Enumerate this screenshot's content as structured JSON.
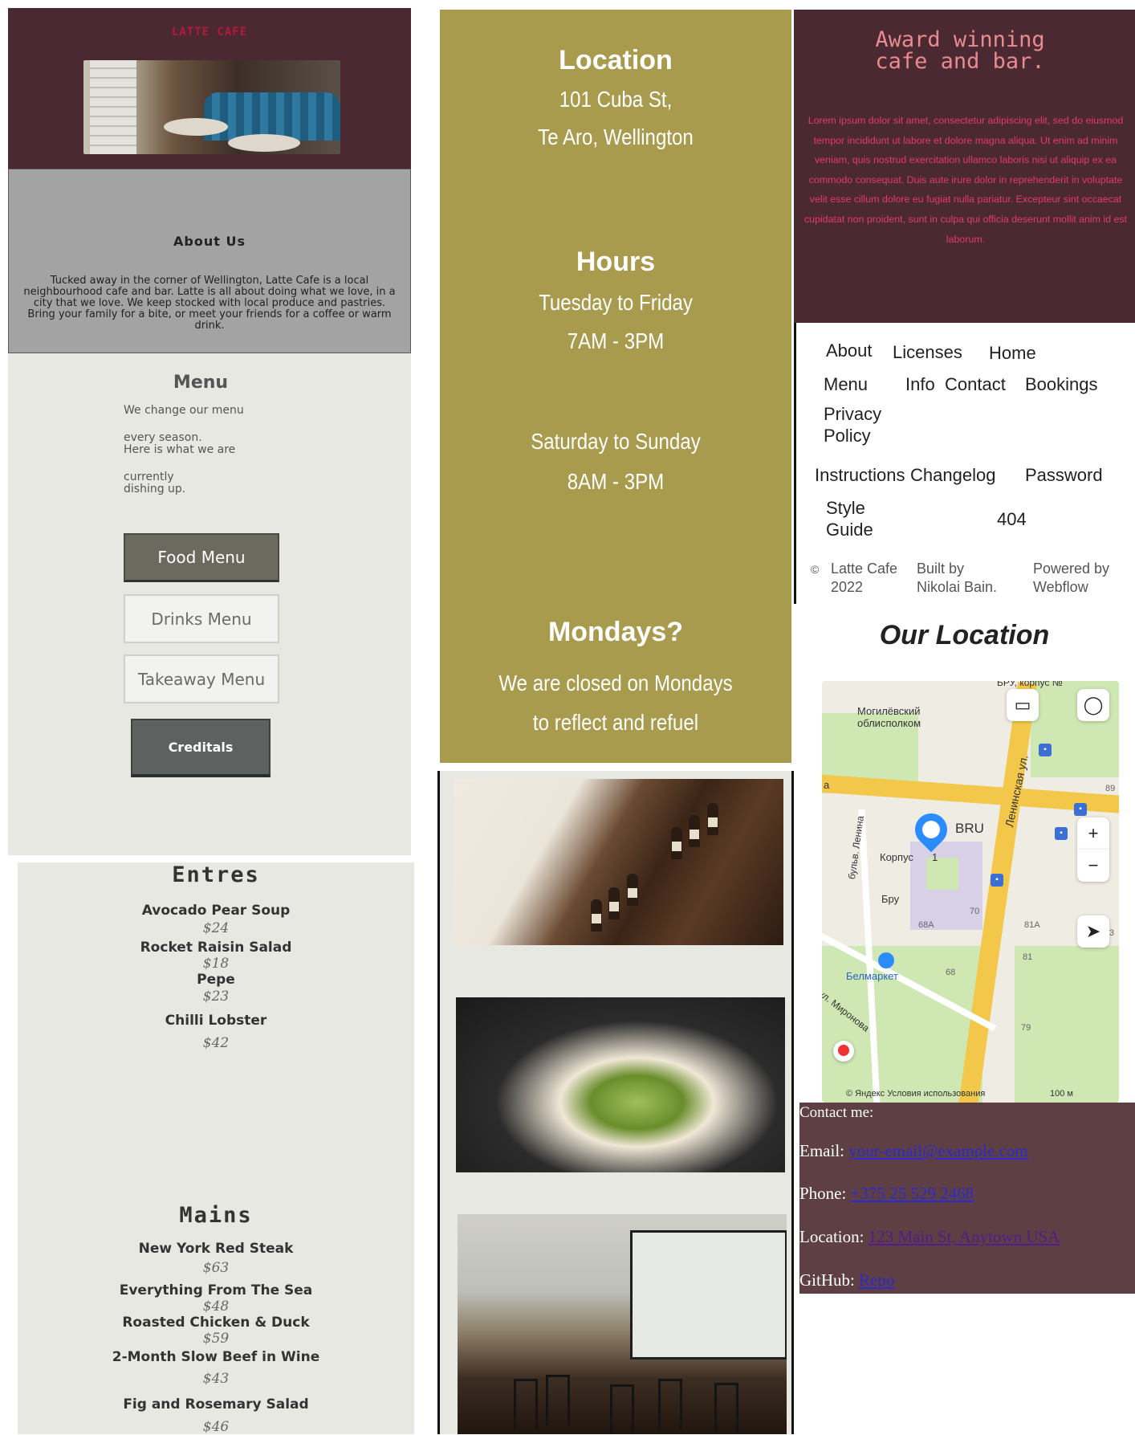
{
  "hero": {
    "brand": "LATTE CAFE"
  },
  "about": {
    "title": "About  Us",
    "text": "Tucked away in the corner of Wellington, Latte Cafe is a local neighbourhood cafe and bar. Latte is all about doing what we love, in a city that we love. We keep stocked with local produce and pastries. Bring your family for a bite, or meet your friends for a coffee or warm drink."
  },
  "menu": {
    "title": "Menu",
    "lines": [
      "We change our menu",
      "every season.",
      "Here is what we are",
      "currently",
      "dishing up."
    ],
    "buttons": {
      "food": "Food Menu",
      "drinks": "Drinks Menu",
      "takeaway": "Takeaway Menu",
      "creditals": "Creditals"
    }
  },
  "food": {
    "entres_title": "Entres",
    "entres": [
      {
        "name": "Avocado Pear Soup",
        "price": "$24"
      },
      {
        "name": "Rocket Raisin Salad",
        "price": "$18"
      },
      {
        "name": "Pepe",
        "price": "$23"
      },
      {
        "name": "Chilli Lobster",
        "price": "$42"
      }
    ],
    "mains_title": "Mains",
    "mains": [
      {
        "name": "New York Red Steak",
        "price": "$63"
      },
      {
        "name": "Everything From The Sea",
        "price": "$48"
      },
      {
        "name": "Roasted Chicken & Duck",
        "price": "$59"
      },
      {
        "name": "2-Month Slow Beef in Wine",
        "price": "$43"
      },
      {
        "name": "Fig and Rosemary Salad",
        "price": "$46"
      }
    ]
  },
  "info": {
    "location_title": "Location",
    "address1": "101 Cuba St,",
    "address2": "Te Aro, Wellington",
    "hours_title": "Hours",
    "weekday": "Tuesday to Friday",
    "weekday_hours": "7AM - 3PM",
    "weekend": "Saturday to Sunday",
    "weekend_hours": "8AM - 3PM",
    "mondays_title": "Mondays?",
    "mondays1": "We are closed on Mondays",
    "mondays2": "to reflect and refuel"
  },
  "award": {
    "title1": "Award winning",
    "title2": "cafe and bar.",
    "text": "Lorem ipsum dolor sit amet, consectetur adipiscing elit, sed do eiusmod tempor incididunt ut labore et dolore magna aliqua. Ut enim ad minim veniam, quis nostrud exercitation ullamco laboris nisi ut aliquip ex ea commodo consequat. Duis aute irure dolor in reprehenderit in voluptate velit esse cillum dolore eu fugiat nulla pariatur. Excepteur sint occaecat cupidatat non proident, sunt in culpa qui officia deserunt mollit anim id est laborum."
  },
  "links": {
    "about": "About",
    "licenses": "Licenses",
    "home": "Home",
    "menu": "Menu",
    "info": "Info",
    "contact": "Contact",
    "bookings": "Bookings",
    "privacy1": "Privacy",
    "privacy2": "Policy",
    "instructions": "Instructions",
    "changelog": "Changelog",
    "password": "Password",
    "style1": "Style",
    "style2": "Guide",
    "notfound": "404",
    "copy_symbol": "©",
    "copy1": "Latte Cafe",
    "copy2": "2022",
    "built1": "Built by",
    "built2": "Nikolai Bain.",
    "powered1": "Powered by",
    "powered2": "Webflow"
  },
  "location": {
    "title": "Our Location"
  },
  "map": {
    "top_label": "БРУ, корпус №",
    "label_mogilev1": "Могилёвский",
    "label_mogilev2": "облисполком",
    "label_bru": "BRU",
    "label_korpus": "Корпус",
    "label_korpus_num": "1",
    "label_bru2": "Бру",
    "street_lenina": "бульв. Ленина",
    "street_leninskaya": "Ленинская ул.",
    "label_belmarket": "Белмаркет",
    "street_mironova": "ул. Миронова",
    "num_68a": "68А",
    "num_70": "70",
    "num_81a": "81А",
    "num_81": "81",
    "num_68": "68",
    "num_79": "79",
    "num_89": "89",
    "edge_a": "а",
    "edge_b": "3",
    "attrib": "© Яндекс  Условия использования",
    "scale": "100 м",
    "zoom_in": "+",
    "zoom_out": "−"
  },
  "contact": {
    "heading": "Contact me:",
    "email_label": "Email: ",
    "email": "your-email@example.com",
    "phone_label": "Phone: ",
    "phone": "+375 25 529 2468",
    "location_label": "Location: ",
    "location": "123 Main St, Anytown USA",
    "github_label": "GitHub: ",
    "github": "Repo"
  },
  "colors": {
    "plum": "#4b2932",
    "mustard": "#a89b4d",
    "stone": "#e8e8e3",
    "contact_bg": "#5e3f44"
  }
}
